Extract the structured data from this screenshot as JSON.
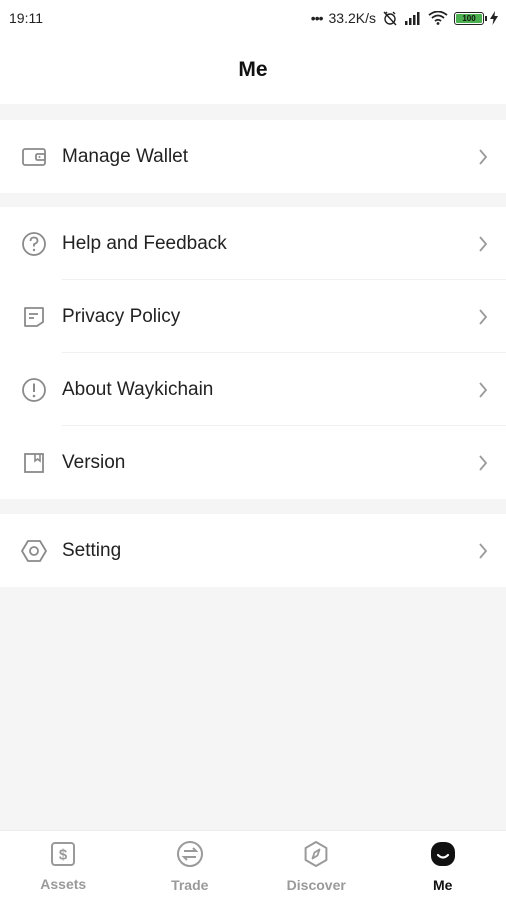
{
  "status_bar": {
    "time": "19:11",
    "network_speed": "33.2K/s",
    "battery": "100"
  },
  "header": {
    "title": "Me"
  },
  "menu": {
    "group1": [
      {
        "label": "Manage Wallet",
        "icon": "wallet-icon"
      }
    ],
    "group2": [
      {
        "label": "Help and Feedback",
        "icon": "help-icon"
      },
      {
        "label": "Privacy Policy",
        "icon": "document-icon"
      },
      {
        "label": "About Waykichain",
        "icon": "info-icon"
      },
      {
        "label": "Version",
        "icon": "bookmark-icon"
      }
    ],
    "group3": [
      {
        "label": "Setting",
        "icon": "settings-icon"
      }
    ]
  },
  "tabbar": {
    "tabs": [
      {
        "label": "Assets",
        "icon": "dollar-icon",
        "active": false
      },
      {
        "label": "Trade",
        "icon": "swap-icon",
        "active": false
      },
      {
        "label": "Discover",
        "icon": "compass-icon",
        "active": false
      },
      {
        "label": "Me",
        "icon": "smile-icon",
        "active": true
      }
    ]
  },
  "colors": {
    "background": "#f5f5f5",
    "surface": "#ffffff",
    "text": "#222222",
    "icon": "#8a8a8a",
    "tab_inactive": "#9a9a9a",
    "tab_active": "#111111",
    "battery": "#4caf50"
  }
}
